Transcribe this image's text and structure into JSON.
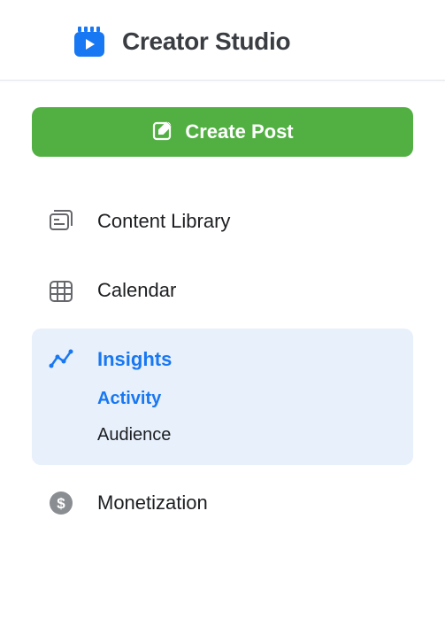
{
  "header": {
    "title": "Creator Studio"
  },
  "create_button": {
    "label": "Create Post"
  },
  "nav": {
    "content_library": "Content Library",
    "calendar": "Calendar",
    "insights": {
      "label": "Insights",
      "activity": "Activity",
      "audience": "Audience"
    },
    "monetization": "Monetization"
  }
}
